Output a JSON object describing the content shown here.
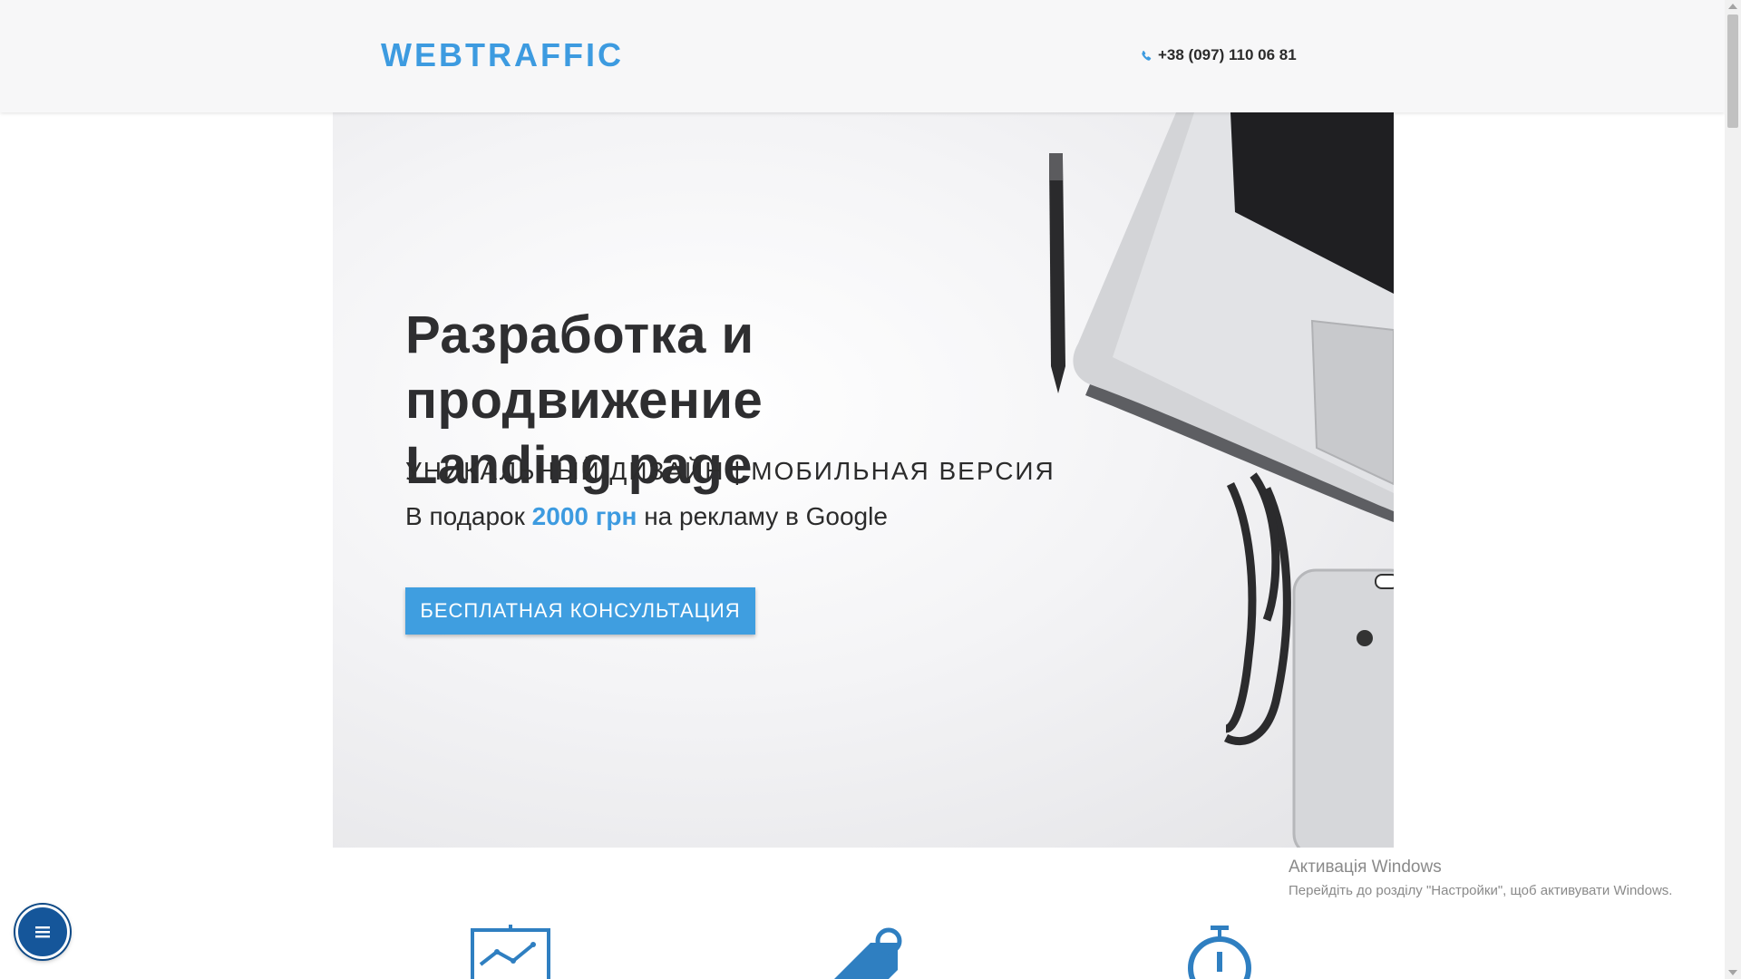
{
  "header": {
    "logo": "WEBTRAFFIC",
    "phone": "+38 (097) 110 06 81"
  },
  "hero": {
    "title_line1": "Разработка и продвижение",
    "title_line2": "Landing page",
    "subtitle": "УНИКАЛЬНЫЙ ДИЗАЙН | МОБИЛЬНАЯ ВЕРСИЯ",
    "gift_prefix": "В подарок ",
    "gift_amount": "2000 грн",
    "gift_suffix": " на рекламу в Google",
    "cta_label": "БЕСПЛАТНАЯ КОНСУЛЬТАЦИЯ"
  },
  "features": [
    {
      "icon": "growth-chart-icon"
    },
    {
      "icon": "price-tag-icon"
    },
    {
      "icon": "stopwatch-icon"
    }
  ],
  "fab": {
    "icon": "menu-icon"
  },
  "watermark": {
    "title": "Активація Windows",
    "text": "Перейдіть до розділу \"Настройки\", щоб активувати Windows."
  },
  "colors": {
    "accent": "#3d9be0",
    "button": "#3f9ee0",
    "fab": "#15569a"
  }
}
